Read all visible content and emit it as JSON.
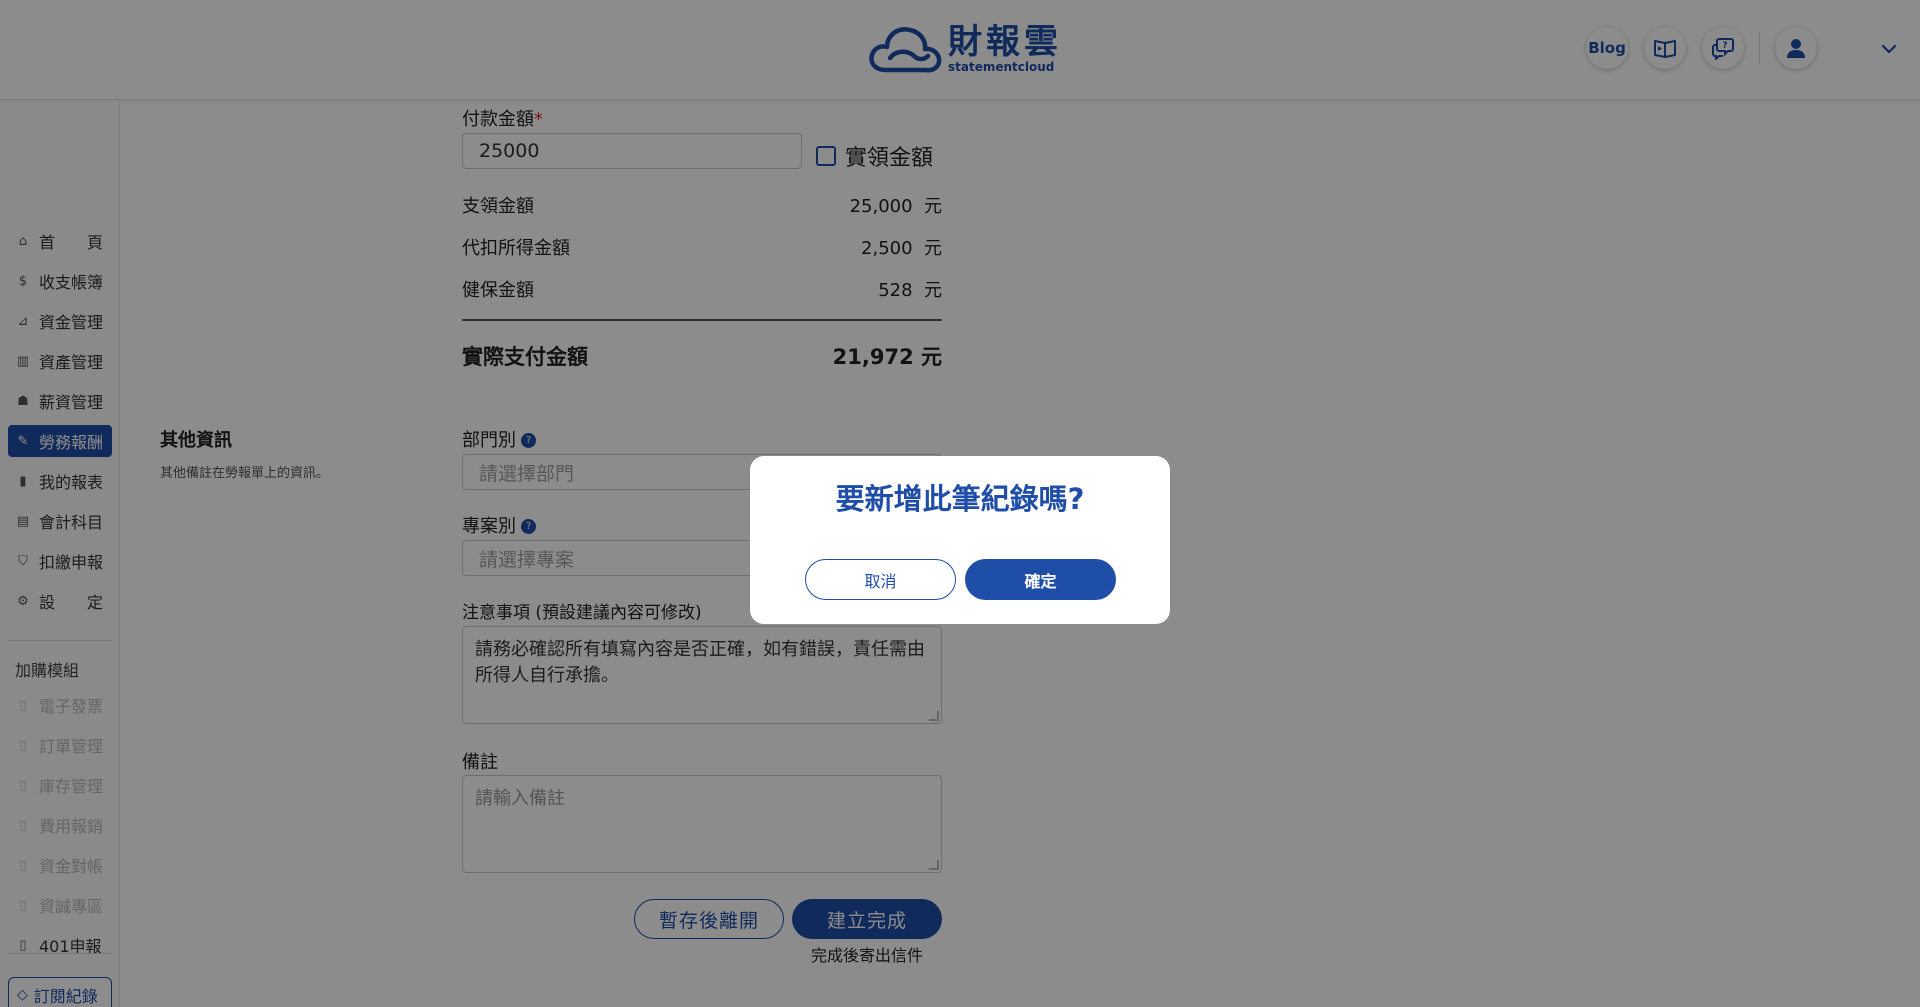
{
  "header": {
    "logo_cn": "財報雲",
    "logo_en": "statementcloud",
    "blog_label": "Blog"
  },
  "sidebar": {
    "items": [
      {
        "label": "首　　頁",
        "icon": "home-icon"
      },
      {
        "label": "收支帳簿",
        "icon": "ledger-icon"
      },
      {
        "label": "資金管理",
        "icon": "funds-icon"
      },
      {
        "label": "資產管理",
        "icon": "assets-icon"
      },
      {
        "label": "薪資管理",
        "icon": "payroll-icon"
      },
      {
        "label": "勞務報酬",
        "icon": "service-fee-icon"
      },
      {
        "label": "我的報表",
        "icon": "report-icon"
      },
      {
        "label": "會計科目",
        "icon": "accounts-icon"
      },
      {
        "label": "扣繳申報",
        "icon": "withholding-icon"
      },
      {
        "label": "設　　定",
        "icon": "settings-icon"
      }
    ],
    "addon_heading": "加購模組",
    "addons": [
      {
        "label": "電子發票",
        "icon": "module-icon"
      },
      {
        "label": "訂單管理",
        "icon": "module-icon"
      },
      {
        "label": "庫存管理",
        "icon": "module-icon"
      },
      {
        "label": "費用報銷",
        "icon": "module-icon"
      },
      {
        "label": "資金對帳",
        "icon": "module-icon"
      },
      {
        "label": "資誠專區",
        "icon": "module-icon"
      },
      {
        "label": "401申報",
        "icon": "module-icon"
      }
    ],
    "subscription_label": "訂閱紀錄"
  },
  "form": {
    "payment_amount_label": "付款金額",
    "payment_amount_value": "25000",
    "actual_received_label": "實領金額",
    "rows": [
      {
        "label": "支領金額",
        "value": "25,000",
        "unit": "元"
      },
      {
        "label": "代扣所得金額",
        "value": "2,500",
        "unit": "元"
      },
      {
        "label": "健保金額",
        "value": "528",
        "unit": "元"
      }
    ],
    "total_label": "實際支付金額",
    "total_value": "21,972",
    "total_unit": "元",
    "other_info_title": "其他資訊",
    "other_info_sub": "其他備註在勞報單上的資訊。",
    "department_label": "部門別",
    "department_placeholder": "請選擇部門",
    "project_label": "專案別",
    "project_placeholder": "請選擇專案",
    "notes_label": "注意事項 (預設建議內容可修改)",
    "notes_value": "請務必確認所有填寫內容是否正確，如有錯誤，責任需由所得人自行承擔。",
    "remark_label": "備註",
    "remark_placeholder": "請輸入備註",
    "save_draft_label": "暫存後離開",
    "complete_label": "建立完成",
    "complete_note": "完成後寄出信件"
  },
  "modal": {
    "title": "要新增此筆紀錄嗎?",
    "cancel_label": "取消",
    "confirm_label": "確定"
  },
  "colors": {
    "brand": "#1f4ea8",
    "required": "#e02020",
    "overlay": "rgba(0,0,0,0.45)"
  }
}
